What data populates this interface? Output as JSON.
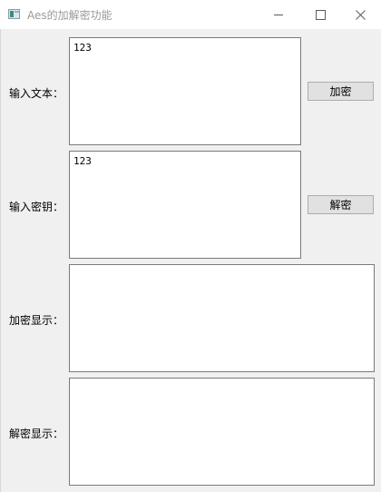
{
  "window": {
    "title": "Aes的加解密功能",
    "controls": {
      "minimize_icon": "minimize-icon",
      "maximize_icon": "maximize-icon",
      "close_icon": "close-icon"
    }
  },
  "form": {
    "input_text": {
      "label": "输入文本：",
      "value": "123"
    },
    "input_key": {
      "label": "输入密钥：",
      "value": "123"
    },
    "encrypted_display": {
      "label": "加密显示：",
      "value": ""
    },
    "decrypted_display": {
      "label": "解密显示：",
      "value": ""
    }
  },
  "buttons": {
    "encrypt_label": "加密",
    "decrypt_label": "解密"
  }
}
